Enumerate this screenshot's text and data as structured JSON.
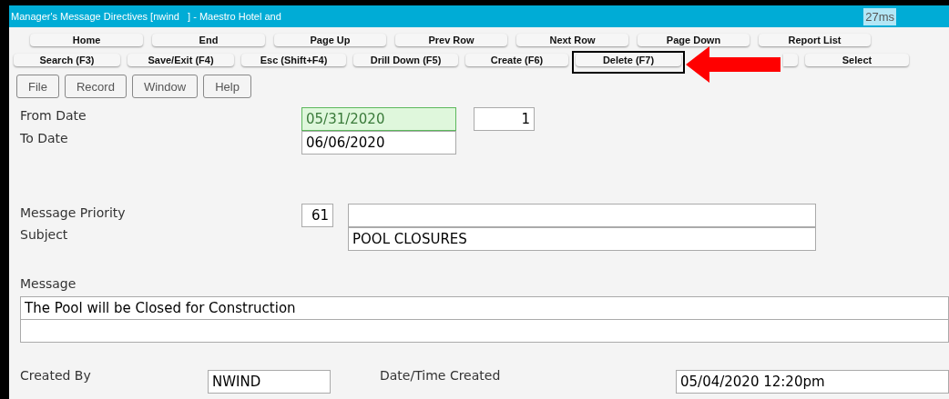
{
  "window": {
    "title": "Manager's Message Directives [nwind   ] - Maestro Hotel and",
    "timing": "27ms"
  },
  "nav_buttons": [
    {
      "label": "Home"
    },
    {
      "label": "End"
    },
    {
      "label": "Page Up"
    },
    {
      "label": "Prev Row"
    },
    {
      "label": "Next Row"
    },
    {
      "label": "Page Down"
    },
    {
      "label": "Report List"
    }
  ],
  "action_buttons": [
    {
      "kind": "text",
      "label": "Search (F3)",
      "highlighted": false
    },
    {
      "kind": "text",
      "label": "Save/Exit (F4)",
      "highlighted": false
    },
    {
      "kind": "text",
      "label": "Esc (Shift+F4)",
      "highlighted": false
    },
    {
      "kind": "text",
      "label": "Drill Down (F5)",
      "highlighted": false
    },
    {
      "kind": "text",
      "label": "Create (F6)",
      "highlighted": false
    },
    {
      "kind": "text",
      "label": "Delete (F7)",
      "highlighted": true
    },
    {
      "kind": "blank",
      "highlighted": false
    },
    {
      "kind": "text",
      "label": "Select",
      "highlighted": false
    }
  ],
  "menu": [
    {
      "label": "File"
    },
    {
      "label": "Record"
    },
    {
      "label": "Window"
    },
    {
      "label": "Help"
    }
  ],
  "form": {
    "from_date": {
      "label": "From Date",
      "value": "05/31/2020",
      "focused": true
    },
    "count": {
      "value": "1"
    },
    "to_date": {
      "label": "To Date",
      "value": "06/06/2020"
    },
    "message_priority": {
      "label": "Message Priority",
      "value": "61"
    },
    "subject": {
      "label": "Subject",
      "value": "POOL CLOSURES"
    },
    "message": {
      "label": "Message",
      "value": "The Pool will be Closed for Construction"
    },
    "created_by": {
      "label": "Created By",
      "value": "NWIND"
    },
    "date_time_created": {
      "label": "Date/Time Created",
      "value": "05/04/2020 12:20pm"
    }
  }
}
